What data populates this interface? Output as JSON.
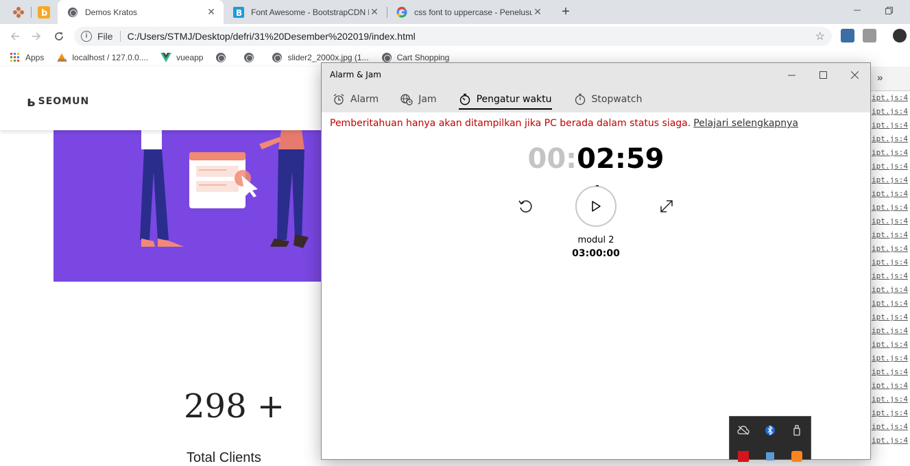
{
  "browser": {
    "tabs": [
      {
        "title": "Demos Kratos",
        "active": true
      },
      {
        "title": "Font Awesome - BootstrapCDN b",
        "active": false
      },
      {
        "title": "css font to uppercase - Penelusur",
        "active": false
      }
    ],
    "omnibox": {
      "scheme": "File",
      "url": "C:/Users/STMJ/Desktop/defri/31%20Desember%202019/index.html"
    },
    "bookmarks": [
      {
        "label": "Apps",
        "icon": "apps-grid-icon"
      },
      {
        "label": "localhost / 127.0.0....",
        "icon": "phpmyadmin-icon"
      },
      {
        "label": "vueapp",
        "icon": "vue-icon"
      },
      {
        "label": "",
        "icon": "globe-icon"
      },
      {
        "label": "",
        "icon": "globe-icon"
      },
      {
        "label": "slider2_2000x.jpg (1...",
        "icon": "globe-icon"
      },
      {
        "label": "Cart Shopping",
        "icon": "globe-icon"
      }
    ]
  },
  "site": {
    "logo_text": "SEOMUN",
    "stat_number": "298 +",
    "stat_label": "Total Clients"
  },
  "devtools": {
    "overflow": "»",
    "line_text": "ipt.js:4",
    "line_count": 26
  },
  "alarm_app": {
    "window_title": "Alarm & Jam",
    "nav": [
      {
        "label": "Alarm",
        "icon": "alarm-clock-icon",
        "active": false
      },
      {
        "label": "Jam",
        "icon": "world-clock-icon",
        "active": false
      },
      {
        "label": "Pengatur waktu",
        "icon": "timer-icon",
        "active": true
      },
      {
        "label": "Stopwatch",
        "icon": "stopwatch-icon",
        "active": false
      }
    ],
    "notice": "Pemberitahuan hanya akan ditampilkan jika PC berada dalam status siaga.",
    "notice_link": "Pelajari selengkapnya",
    "timer_dim": "00:",
    "timer_bright": "02:59",
    "timer_name": "modul 2",
    "timer_duration": "03:00:00"
  },
  "colors": {
    "hero": "#7a47e2",
    "notice": "#c00000",
    "tab_strip": "#dee1e6"
  }
}
